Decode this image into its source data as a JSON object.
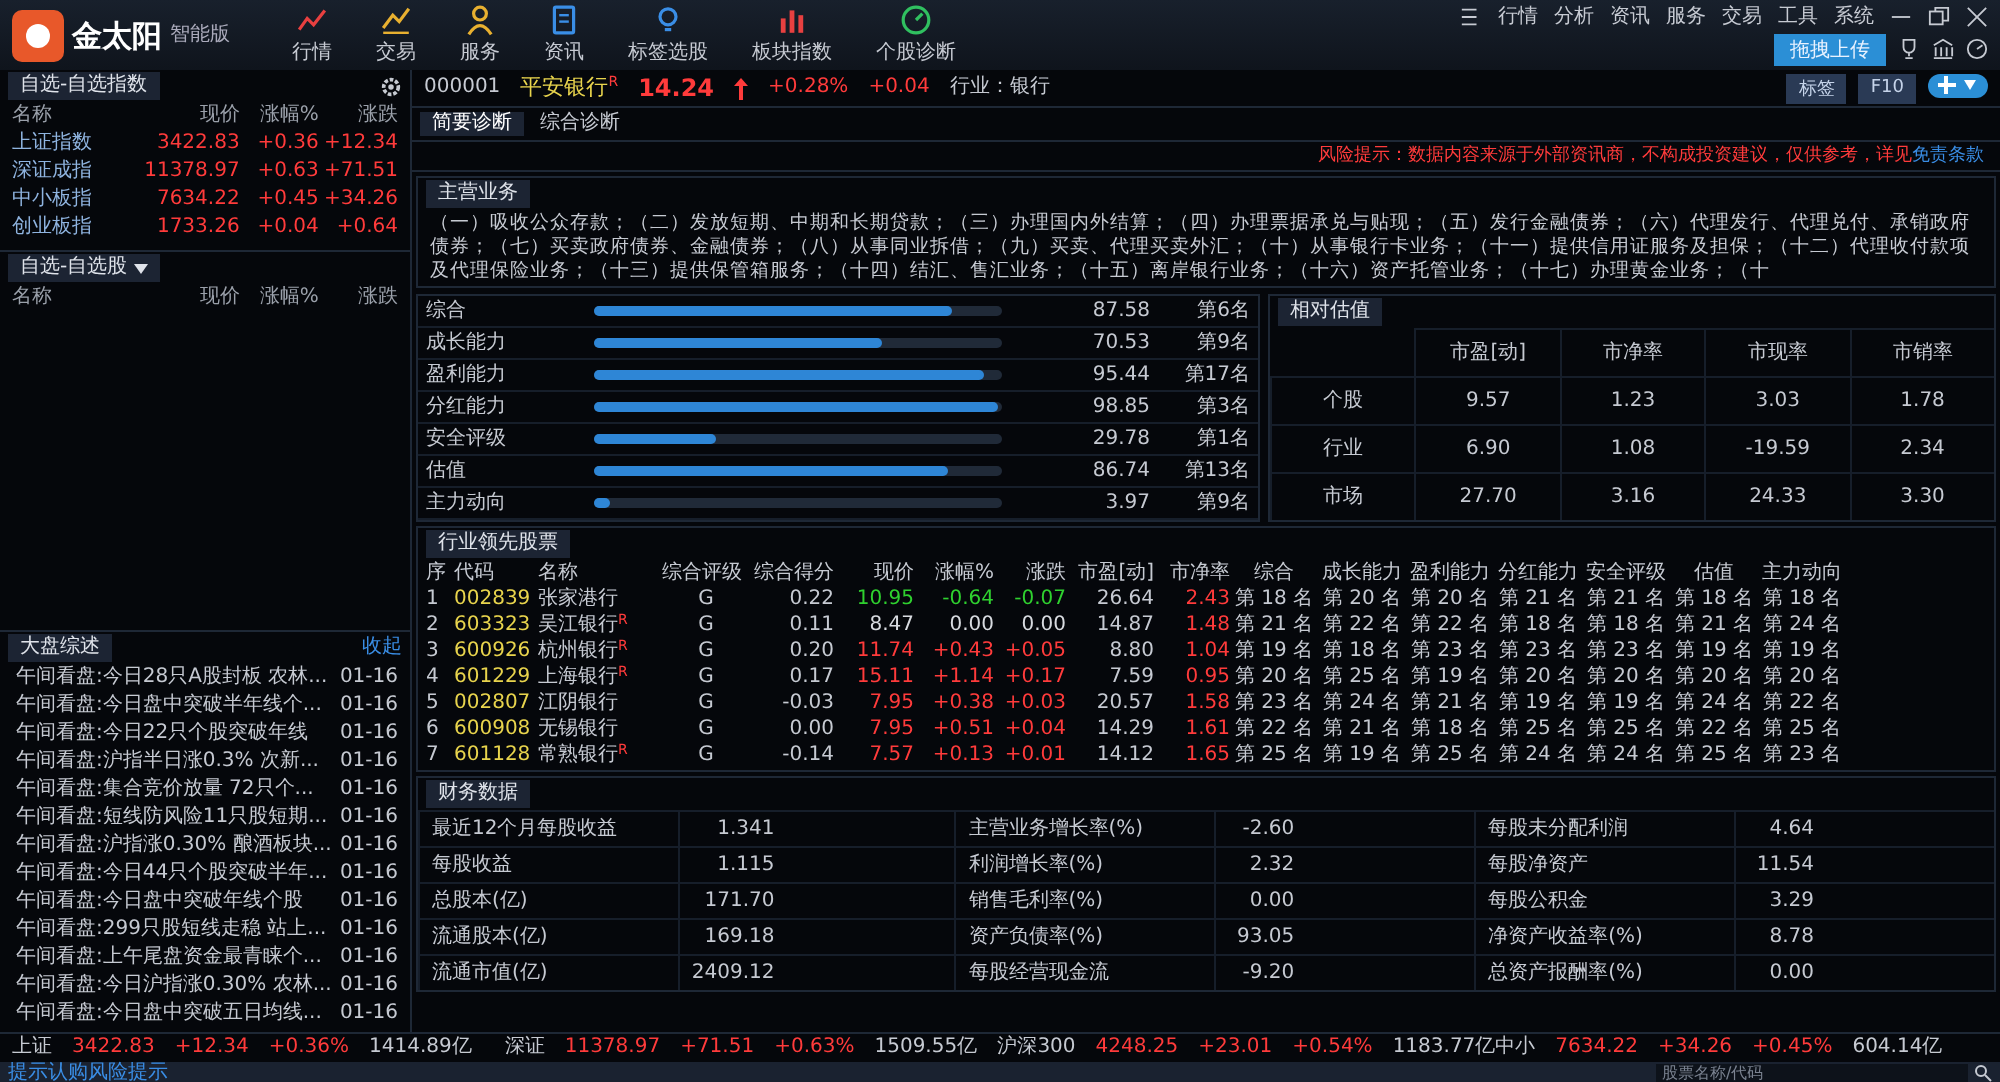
{
  "app": {
    "logo_text": "金太阳",
    "edition": "智能版"
  },
  "nav": [
    {
      "label": "行情",
      "kind": "line"
    },
    {
      "label": "交易",
      "kind": "trend"
    },
    {
      "label": "服务",
      "kind": "person"
    },
    {
      "label": "资讯",
      "kind": "doc"
    },
    {
      "label": "标签选股",
      "kind": "bulb"
    },
    {
      "label": "板块指数",
      "kind": "bars"
    },
    {
      "label": "个股诊断",
      "kind": "gauge"
    }
  ],
  "menu": [
    "行情",
    "分析",
    "资讯",
    "服务",
    "交易",
    "工具",
    "系统"
  ],
  "upload_popup": {
    "label": "拖拽上传"
  },
  "index_panel": {
    "title": "自选-自选指数",
    "columns": [
      "名称",
      "现价",
      "涨幅%",
      "涨跌"
    ],
    "rows": [
      {
        "name": "上证指数",
        "price": "3422.83",
        "change_pct": "+0.36",
        "change": "+12.34"
      },
      {
        "name": "深证成指",
        "price": "11378.97",
        "change_pct": "+0.63",
        "change": "+71.51"
      },
      {
        "name": "中小板指",
        "price": "7634.22",
        "change_pct": "+0.45",
        "change": "+34.26"
      },
      {
        "name": "创业板指",
        "price": "1733.26",
        "change_pct": "+0.04",
        "change": "+0.64"
      }
    ]
  },
  "watchlist": {
    "title": "自选-自选股",
    "columns": [
      "名称",
      "现价",
      "涨幅%",
      "涨跌"
    ]
  },
  "news": {
    "title": "大盘综述",
    "action": "收起",
    "items": [
      {
        "title": "午间看盘:今日28只A股封板 农林...",
        "date": "01-16"
      },
      {
        "title": "午间看盘:今日盘中突破半年线个...",
        "date": "01-16"
      },
      {
        "title": "午间看盘:今日22只个股突破年线",
        "date": "01-16"
      },
      {
        "title": "午间看盘:沪指半日涨0.3% 次新...",
        "date": "01-16"
      },
      {
        "title": "午间看盘:集合竞价放量 72只个...",
        "date": "01-16"
      },
      {
        "title": "午间看盘:短线防风险11只股短期...",
        "date": "01-16"
      },
      {
        "title": "午间看盘:沪指涨0.30% 酿酒板块...",
        "date": "01-16"
      },
      {
        "title": "午间看盘:今日44只个股突破半年...",
        "date": "01-16"
      },
      {
        "title": "午间看盘:今日盘中突破年线个股",
        "date": "01-16"
      },
      {
        "title": "午间看盘:299只股短线走稳 站上...",
        "date": "01-16"
      },
      {
        "title": "午间看盘:上午尾盘资金最青睐个...",
        "date": "01-16"
      },
      {
        "title": "午间看盘:今日沪指涨0.30% 农林...",
        "date": "01-16"
      },
      {
        "title": "午间看盘:今日盘中突破五日均线...",
        "date": "01-16"
      }
    ]
  },
  "stock": {
    "code": "000001",
    "name": "平安银行",
    "mark": "R",
    "price": "14.24",
    "change_pct": "+0.28%",
    "change": "+0.04",
    "industry": "行业：银行",
    "buttons": [
      "标签",
      "F10"
    ]
  },
  "tabs": [
    {
      "label": "简要诊断",
      "selected": true
    },
    {
      "label": "综合诊断",
      "selected": false
    }
  ],
  "risk_notice": {
    "text": "风险提示：数据内容来源于外部资讯商，不构成投资建议，仅供参考，详见",
    "link": "免责条款"
  },
  "business": {
    "title": "主营业务",
    "text": "（一）吸收公众存款；（二）发放短期、中期和长期贷款；（三）办理国内外结算；（四）办理票据承兑与贴现；（五）发行金融债券；（六）代理发行、代理兑付、承销政府债券；（七）买卖政府债券、金融债券；（八）从事同业拆借；（九）买卖、代理买卖外汇；（十）从事银行卡业务；（十一）提供信用证服务及担保；（十二）代理收付款项及代理保险业务；（十三）提供保管箱服务；（十四）结汇、售汇业务；（十五）离岸银行业务；（十六）资产托管业务；（十七）办理黄金业务；（十"
  },
  "scores": [
    {
      "name": "综合",
      "level": 0.876,
      "score": "87.58",
      "rank": "第6名"
    },
    {
      "name": "成长能力",
      "level": 0.705,
      "score": "70.53",
      "rank": "第9名"
    },
    {
      "name": "盈利能力",
      "level": 0.954,
      "score": "95.44",
      "rank": "第17名"
    },
    {
      "name": "分红能力",
      "level": 0.989,
      "score": "98.85",
      "rank": "第3名"
    },
    {
      "name": "安全评级",
      "level": 0.298,
      "score": "29.78",
      "rank": "第1名"
    },
    {
      "name": "估值",
      "level": 0.867,
      "score": "86.74",
      "rank": "第13名"
    },
    {
      "name": "主力动向",
      "level": 0.04,
      "score": "3.97",
      "rank": "第9名"
    }
  ],
  "valuation": {
    "title": "相对估值",
    "columns": [
      "市盈[动]",
      "市净率",
      "市现率",
      "市销率"
    ],
    "rows": [
      {
        "label": "个股",
        "values": [
          "9.57",
          "1.23",
          "3.03",
          "1.78"
        ]
      },
      {
        "label": "行业",
        "values": [
          "6.90",
          "1.08",
          "-19.59",
          "2.34"
        ]
      },
      {
        "label": "市场",
        "values": [
          "27.70",
          "3.16",
          "24.33",
          "3.30"
        ]
      }
    ]
  },
  "industry": {
    "title": "行业领先股票",
    "columns": [
      "序",
      "代码",
      "名称",
      "综合评级",
      "综合得分",
      "现价",
      "涨幅%",
      "涨跌",
      "市盈[动]",
      "市净率",
      "综合",
      "成长能力",
      "盈利能力",
      "分红能力",
      "安全评级",
      "估值",
      "主力动向"
    ],
    "rows": [
      {
        "no": "1",
        "code": "002839",
        "name": "张家港行",
        "rating": "G",
        "score": "0.22",
        "price": "10.95",
        "change_pct": "-0.64",
        "change": "-0.07",
        "pe": "26.64",
        "pb": "2.43",
        "ranks": [
          "第 18 名",
          "第 20 名",
          "第 20 名",
          "第 21 名",
          "第 21 名",
          "第 18 名",
          "第 18 名"
        ]
      },
      {
        "no": "2",
        "code": "603323",
        "name": "吴江银行",
        "mark": "R",
        "rating": "G",
        "score": "0.11",
        "price": "8.47",
        "change_pct": "0.00",
        "change": "0.00",
        "pe": "14.87",
        "pb": "1.48",
        "ranks": [
          "第 21 名",
          "第 22 名",
          "第 22 名",
          "第 18 名",
          "第 18 名",
          "第 21 名",
          "第 24 名"
        ]
      },
      {
        "no": "3",
        "code": "600926",
        "name": "杭州银行",
        "mark": "R",
        "rating": "G",
        "score": "0.20",
        "price": "11.74",
        "change_pct": "+0.43",
        "change": "+0.05",
        "pe": "8.80",
        "pb": "1.04",
        "ranks": [
          "第 19 名",
          "第 18 名",
          "第 23 名",
          "第 23 名",
          "第 23 名",
          "第 19 名",
          "第 19 名"
        ]
      },
      {
        "no": "4",
        "code": "601229",
        "name": "上海银行",
        "mark": "R",
        "rating": "G",
        "score": "0.17",
        "price": "15.11",
        "change_pct": "+1.14",
        "change": "+0.17",
        "pe": "7.59",
        "pb": "0.95",
        "ranks": [
          "第 20 名",
          "第 25 名",
          "第 19 名",
          "第 20 名",
          "第 20 名",
          "第 20 名",
          "第 20 名"
        ]
      },
      {
        "no": "5",
        "code": "002807",
        "name": "江阴银行",
        "rating": "G",
        "score": "-0.03",
        "price": "7.95",
        "change_pct": "+0.38",
        "change": "+0.03",
        "pe": "20.57",
        "pb": "1.58",
        "ranks": [
          "第 23 名",
          "第 24 名",
          "第 21 名",
          "第 19 名",
          "第 19 名",
          "第 24 名",
          "第 22 名"
        ]
      },
      {
        "no": "6",
        "code": "600908",
        "name": "无锡银行",
        "rating": "G",
        "score": "0.00",
        "price": "7.95",
        "change_pct": "+0.51",
        "change": "+0.04",
        "pe": "14.29",
        "pb": "1.61",
        "ranks": [
          "第 22 名",
          "第 21 名",
          "第 18 名",
          "第 25 名",
          "第 25 名",
          "第 22 名",
          "第 25 名"
        ]
      },
      {
        "no": "7",
        "code": "601128",
        "name": "常熟银行",
        "mark": "R",
        "rating": "G",
        "score": "-0.14",
        "price": "7.57",
        "change_pct": "+0.13",
        "change": "+0.01",
        "pe": "14.12",
        "pb": "1.65",
        "ranks": [
          "第 25 名",
          "第 19 名",
          "第 25 名",
          "第 24 名",
          "第 24 名",
          "第 25 名",
          "第 23 名"
        ]
      }
    ]
  },
  "finance": {
    "title": "财务数据",
    "rows": [
      {
        "cells": [
          {
            "label": "最近12个月每股收益",
            "value": "1.341"
          },
          {
            "label": "主营业务增长率(%)",
            "value": "-2.60"
          },
          {
            "label": "每股未分配利润",
            "value": "4.64"
          }
        ]
      },
      {
        "cells": [
          {
            "label": "每股收益",
            "value": "1.115"
          },
          {
            "label": "利润增长率(%)",
            "value": "2.32"
          },
          {
            "label": "每股净资产",
            "value": "11.54"
          }
        ]
      },
      {
        "cells": [
          {
            "label": "总股本(亿)",
            "value": "171.70"
          },
          {
            "label": "销售毛利率(%)",
            "value": "0.00"
          },
          {
            "label": "每股公积金",
            "value": "3.29"
          }
        ]
      },
      {
        "cells": [
          {
            "label": "流通股本(亿)",
            "value": "169.18"
          },
          {
            "label": "资产负债率(%)",
            "value": "93.05"
          },
          {
            "label": "净资产收益率(%)",
            "value": "8.78"
          }
        ]
      },
      {
        "cells": [
          {
            "label": "流通市值(亿)",
            "value": "2409.12"
          },
          {
            "label": "每股经营现金流",
            "value": "-9.20"
          },
          {
            "label": "总资产报酬率(%)",
            "value": "0.00"
          }
        ]
      }
    ]
  },
  "status_bar": [
    {
      "name": "上证",
      "price": "3422.83",
      "change": "+12.34",
      "change_pct": "+0.36%",
      "volume": "1414.89亿"
    },
    {
      "name": "深证",
      "price": "11378.97",
      "change": "+71.51",
      "change_pct": "+0.63%",
      "volume": "1509.55亿"
    },
    {
      "name": "沪深300",
      "price": "4248.25",
      "change": "+23.01",
      "change_pct": "+0.54%",
      "volume": "1183.77亿"
    },
    {
      "name": "中小",
      "price": "7634.22",
      "change": "+34.26",
      "change_pct": "+0.45%",
      "volume": "604.14亿"
    }
  ],
  "bottom": {
    "notice": "提示认购风险提示",
    "search_placeholder": "股票名称/代码"
  }
}
